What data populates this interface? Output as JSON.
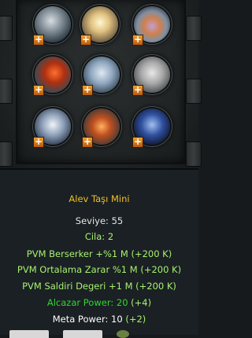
{
  "item": {
    "name": "Alev Taşı Mini",
    "level": "Seviye: 55",
    "polish": "Cila: 2",
    "attrs": [
      {
        "text": "PVM Berserker +%1 M (+200 K)"
      },
      {
        "text": "PVM Ortalama Zarar %1 M (+200 K)"
      },
      {
        "text": "PVM Saldiri Degeri +1 M (+200 K)"
      }
    ],
    "alcazar_label": "Alcazar Power: 20",
    "alcazar_bonus": "(+4)",
    "meta_label": "Meta Power: 10",
    "meta_bonus": "(+2)"
  },
  "colors": {
    "name": "#f0c020",
    "white": "#e6e6e6",
    "green": "#a8f070",
    "bright_green": "#30d830"
  },
  "stones": [
    {
      "icon": "wind-stone-icon"
    },
    {
      "icon": "light-stone-icon"
    },
    {
      "icon": "rainbow-stone-icon"
    },
    {
      "icon": "fire-stone-icon"
    },
    {
      "icon": "ice-stone-icon"
    },
    {
      "icon": "cloud-stone-icon"
    },
    {
      "icon": "storm-stone-icon"
    },
    {
      "icon": "flame-stone-icon"
    },
    {
      "icon": "night-stone-icon"
    }
  ]
}
